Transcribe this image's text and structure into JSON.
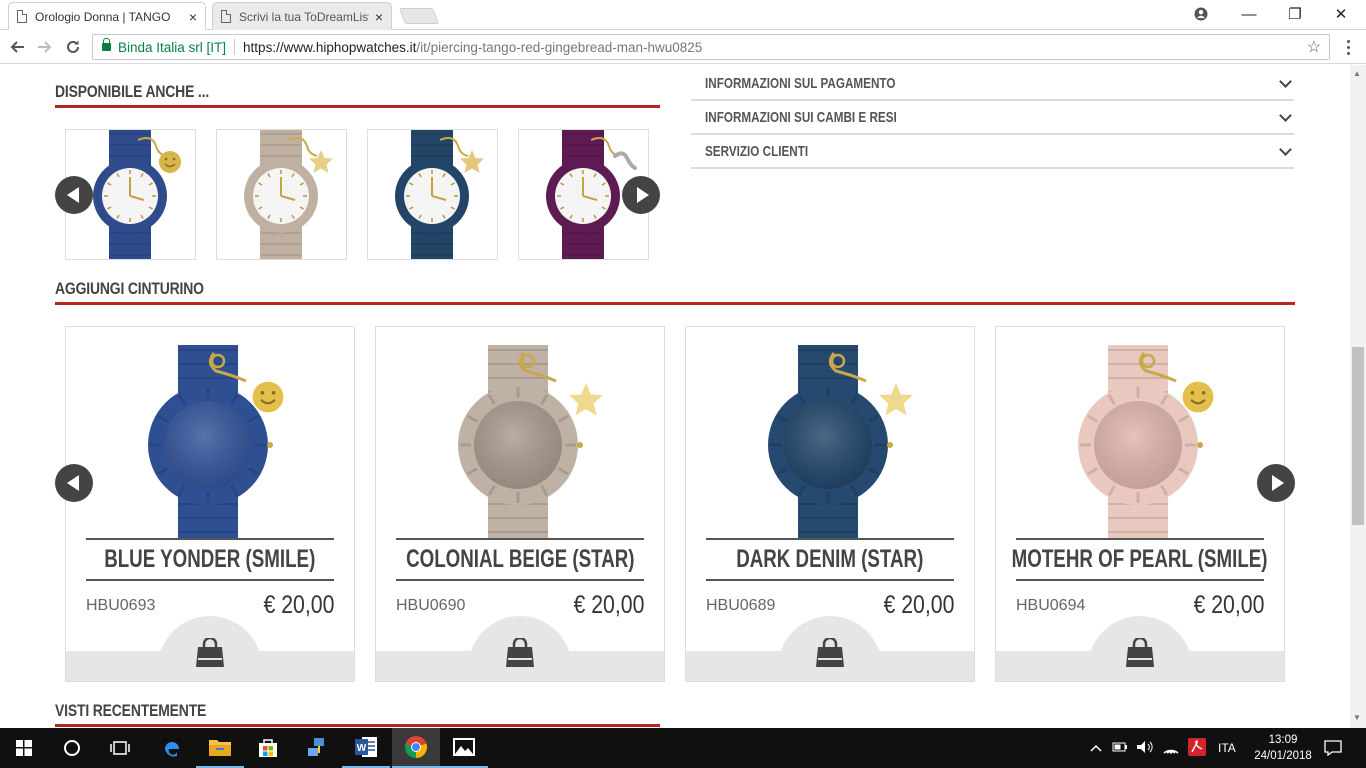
{
  "browser": {
    "tabs": [
      {
        "title": "Orologio Donna | TANGO",
        "close": "×"
      },
      {
        "title": "Scrivi la tua ToDreamList",
        "close": "×"
      }
    ],
    "window_controls": {
      "minimize": "—",
      "maximize": "❐",
      "close": "✕"
    },
    "omnibox": {
      "secure_label": "Binda Italia srl [IT]",
      "url_host": "https://www.hiphopwatches.it",
      "url_path": "/it/piercing-tango-red-gingebread-man-hwu0825"
    }
  },
  "page": {
    "available_title": "DISPONIBILE ANCHE ...",
    "available_thumbs": [
      {
        "strap": "#2f4b8c",
        "charm": "smile",
        "charm_color": "#d8b548"
      },
      {
        "strap": "#bfb0a2",
        "charm": "star",
        "charm_color": "#e7cf86"
      },
      {
        "strap": "#234567",
        "charm": "star",
        "charm_color": "#e2c77c"
      },
      {
        "strap": "#5e1a52",
        "charm": "snake",
        "charm_color": "#aaaaaa"
      }
    ],
    "accordion": [
      {
        "label": "INFORMAZIONI SUL PAGAMENTO"
      },
      {
        "label": "INFORMAZIONI SUI CAMBI E RESI"
      },
      {
        "label": "SERVIZIO CLIENTI"
      }
    ],
    "straps_title": "AGGIUNGI CINTURINO",
    "straps": [
      {
        "name": "BLUE YONDER (SMILE)",
        "sku": "HBU0693",
        "price": "€ 20,00",
        "color": "#2f4f93",
        "face": "#34569c",
        "charm": "smile"
      },
      {
        "name": "COLONIAL BEIGE (STAR)",
        "sku": "HBU0690",
        "price": "€ 20,00",
        "color": "#bfb1a4",
        "face": "#a99d8f",
        "charm": "star"
      },
      {
        "name": "DARK DENIM (STAR)",
        "sku": "HBU0689",
        "price": "€ 20,00",
        "color": "#25496f",
        "face": "#24476c",
        "charm": "star"
      },
      {
        "name": "MOTEHR OF PEARL (SMILE)",
        "sku": "HBU0694",
        "price": "€ 20,00",
        "color": "#e9c9bf",
        "face": "#dfb6ad",
        "charm": "smile"
      }
    ],
    "recent_title": "VISTI RECENTEMENTE"
  },
  "taskbar": {
    "apps": [
      "start-icon",
      "cortana-icon",
      "task-view-icon",
      "edge-icon",
      "file-explorer-icon",
      "store-icon",
      "network-app-icon",
      "word-icon",
      "chrome-icon",
      "photos-icon"
    ],
    "language": "ITA",
    "time": "13:09",
    "date": "24/01/2018"
  }
}
